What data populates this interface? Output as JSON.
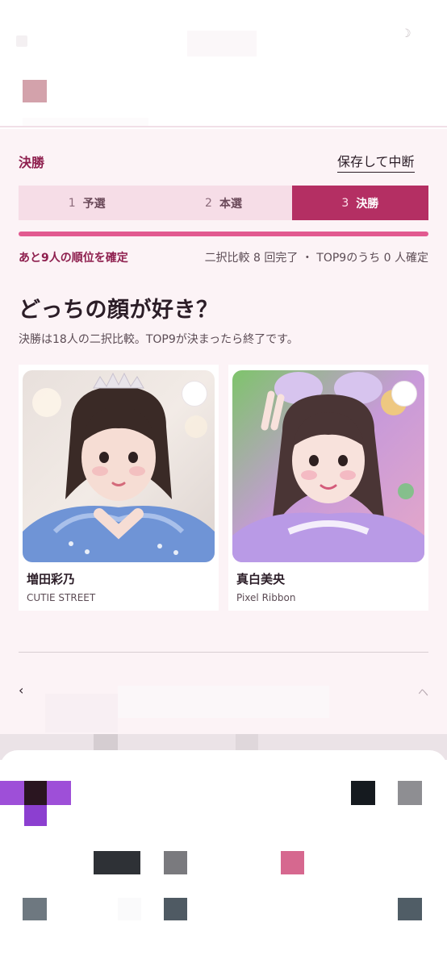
{
  "header": {
    "stage_title": "決勝",
    "save_label": "保存して中断"
  },
  "steps": [
    {
      "num": "1",
      "label": "予選",
      "active": false
    },
    {
      "num": "2",
      "label": "本選",
      "active": false
    },
    {
      "num": "3",
      "label": "決勝",
      "active": true
    }
  ],
  "progress": {
    "fraction": 1.0,
    "remaining_text": "あと9人の順位を確定",
    "stats_text": "二択比較 8 回完了 ・ TOP9のうち 0 人確定"
  },
  "question": {
    "title": "どっちの顔が好き？",
    "description": "決勝は18人の二択比較。TOP9が決まったら終了です。"
  },
  "candidates": [
    {
      "name": "増田彩乃",
      "group": "CUTIE STREET"
    },
    {
      "name": "真白美央",
      "group": "Pixel Ribbon"
    }
  ],
  "nav": {
    "prev_arrow": "‹",
    "next_hint": "ヘ"
  },
  "colors": {
    "accent": "#b42f63",
    "accent_text": "#8e1f4e",
    "panel_bg": "#fcf3f6",
    "step_bg": "#f6dde7",
    "progress_fill": "#e25a90"
  },
  "icons": {
    "select": "circle-select-icon",
    "prev": "chevron-left-icon"
  }
}
